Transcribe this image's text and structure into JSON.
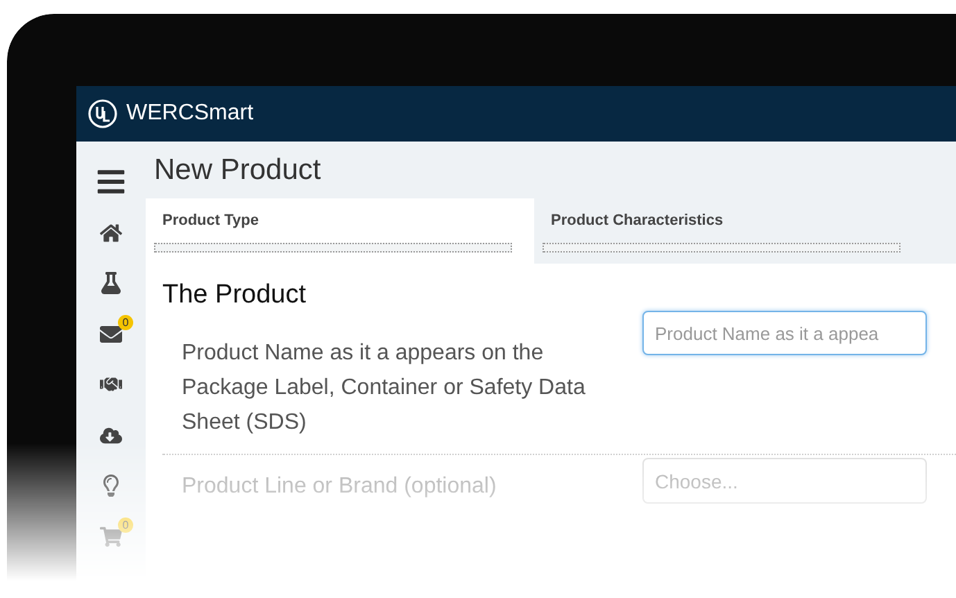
{
  "app": {
    "name": "WERCSmart"
  },
  "page": {
    "title": "New Product"
  },
  "sidebar": {
    "items": [
      {
        "kind": "menu"
      },
      {
        "kind": "home"
      },
      {
        "kind": "flask"
      },
      {
        "kind": "mail",
        "badge": "0"
      },
      {
        "kind": "handshake"
      },
      {
        "kind": "download"
      },
      {
        "kind": "bulb"
      },
      {
        "kind": "cart",
        "badge": "0"
      }
    ]
  },
  "tabs": [
    {
      "label": "Product Type",
      "selected": true,
      "level": 0
    },
    {
      "label": "Product Characteristics",
      "selected": false,
      "level": 0
    }
  ],
  "section": {
    "title": "The Product"
  },
  "fields": [
    {
      "kind": "text",
      "label": "Product Name as it a appears on the Package Label, Container or Safety Data Sheet (SDS)",
      "placeholder": "Product Name as it a appea",
      "focused": true
    },
    {
      "kind": "select",
      "label": "Product Line or Brand (optional)",
      "placeholder": "Choose...",
      "focused": false
    }
  ]
}
